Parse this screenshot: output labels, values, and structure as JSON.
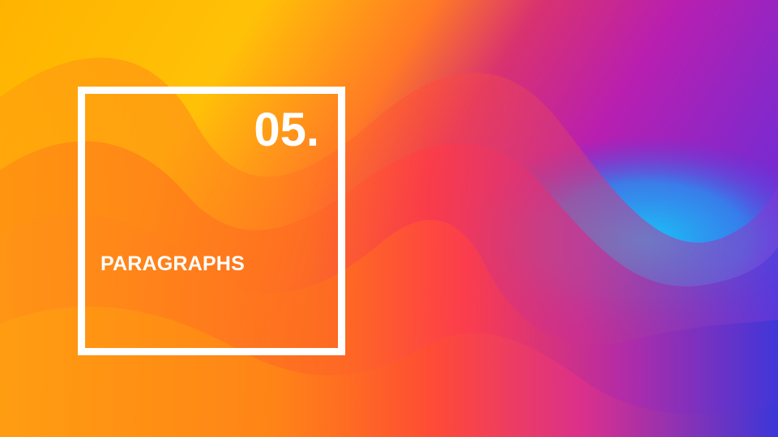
{
  "slide": {
    "number": "05.",
    "heading": "PARAGRAPHS"
  },
  "colors": {
    "frame": "#ffffff",
    "text": "#ffffff",
    "yellow": "#ffc107",
    "orange": "#ff8a1a",
    "red": "#ff3d45",
    "magenta": "#c21ea8",
    "purple": "#8a2bd6",
    "cyan": "#1ab8f5",
    "blue": "#3a36d8"
  }
}
